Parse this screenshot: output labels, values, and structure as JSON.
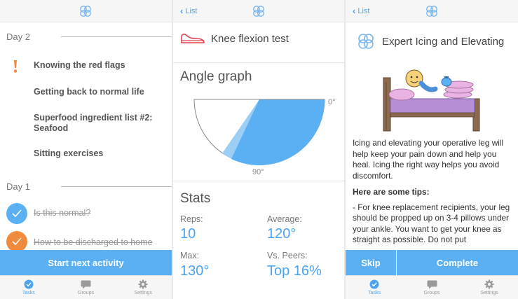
{
  "tasks_screen": {
    "day2_label": "Day 2",
    "day2_items": [
      "Knowing the red flags",
      "Getting back to normal life",
      "Superfood ingredient list #2: Seafood",
      "Sitting exercises"
    ],
    "day1_label": "Day 1",
    "day1_items": [
      "Is this normal?",
      "How to be discharged to home"
    ],
    "start_button": "Start next activity"
  },
  "test_screen": {
    "back_label": "List",
    "title": "Knee flexion test",
    "graph_title": "Angle graph",
    "angle_0_label": "0°",
    "angle_90_label": "90°",
    "stats_title": "Stats",
    "reps_label": "Reps:",
    "reps_value": "10",
    "average_label": "Average:",
    "average_value": "120°",
    "max_label": "Max:",
    "max_value": "130°",
    "peers_label": "Vs. Peers:",
    "peers_value": "Top 16%"
  },
  "article_screen": {
    "back_label": "List",
    "title": "Expert Icing and Elevating",
    "paragraph": "Icing and elevating your operative leg will help keep your pain down and help you heal. Icing the right way helps you avoid discomfort.",
    "tips_title": "Here are some tips:",
    "tip_1": "-  For knee replacement recipients, your leg should be propped up on 3-4 pillows under your ankle. You want to get your knee as straight as possible. Do not put",
    "skip_button": "Skip",
    "complete_button": "Complete"
  },
  "tab_labels": [
    "Tasks",
    "Groups",
    "Settings"
  ],
  "colors": {
    "accent_blue": "#5ab0f2",
    "alert_orange": "#f08a3c",
    "check_blue": "#5ab0f2",
    "check_orange": "#f08a3c"
  }
}
